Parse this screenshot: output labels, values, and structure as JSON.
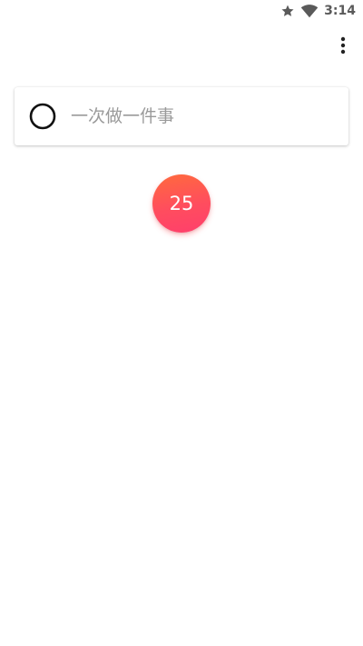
{
  "status_bar": {
    "time": "3:14",
    "icons": [
      "star-icon",
      "wifi-icon"
    ],
    "icon_color": "#5a5a5a"
  },
  "toolbar": {
    "menu_icon": "more-vert-icon"
  },
  "task": {
    "placeholder": "一次做一件事",
    "value": "",
    "checkbox_icon": "circle-outline-icon"
  },
  "timer": {
    "minutes": "25",
    "gradient_start": "#ff6a3d",
    "gradient_end": "#ff3f6c"
  }
}
